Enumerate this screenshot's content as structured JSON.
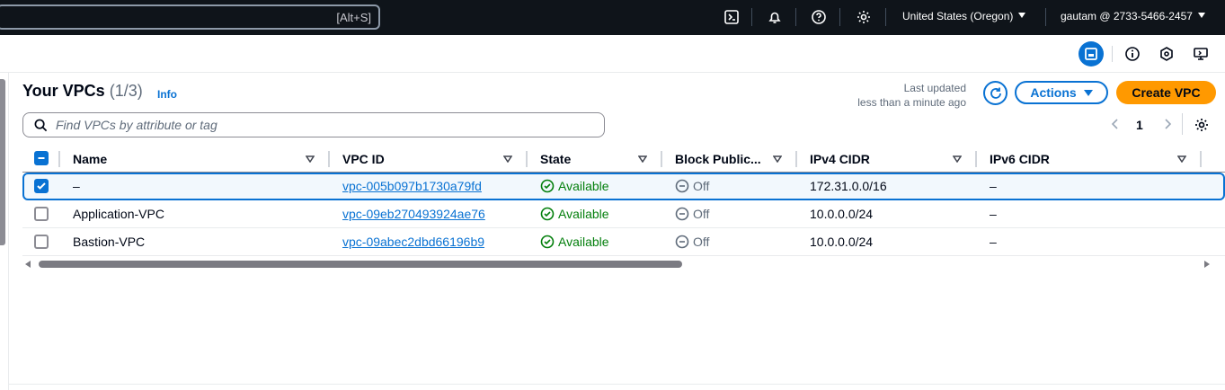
{
  "console": {
    "search_shortcut": "[Alt+S]",
    "region": "United States (Oregon)",
    "account": "gautam @ 2733-5466-2457"
  },
  "panel": {
    "title": "Your VPCs",
    "count": "(1/3)",
    "info_label": "Info",
    "last_updated_label": "Last updated",
    "last_updated_value": "less than a minute ago",
    "actions_label": "Actions",
    "create_label": "Create VPC",
    "filter_placeholder": "Find VPCs by attribute or tag",
    "page_number": "1"
  },
  "table": {
    "columns": [
      "Name",
      "VPC ID",
      "State",
      "Block Public...",
      "IPv4 CIDR",
      "IPv6 CIDR"
    ],
    "rows": [
      {
        "selected": true,
        "name": "–",
        "vpc_id": "vpc-005b097b1730a79fd",
        "state": "Available",
        "block_public": "Off",
        "ipv4": "172.31.0.0/16",
        "ipv6": "–"
      },
      {
        "selected": false,
        "name": "Application-VPC",
        "vpc_id": "vpc-09eb270493924ae76",
        "state": "Available",
        "block_public": "Off",
        "ipv4": "10.0.0.0/24",
        "ipv6": "–"
      },
      {
        "selected": false,
        "name": "Bastion-VPC",
        "vpc_id": "vpc-09abec2dbd66196b9",
        "state": "Available",
        "block_public": "Off",
        "ipv4": "10.0.0.0/24",
        "ipv6": "–"
      }
    ]
  },
  "colors": {
    "topbar": "#0f141a",
    "accent": "#0972d3",
    "primary_button": "#ff9900",
    "success": "#037f0c"
  },
  "icons": [
    "cloudshell-icon",
    "bell-icon",
    "help-icon",
    "gear-icon",
    "panel-icon",
    "info-icon",
    "hexagon-icon",
    "remote-icon",
    "search-icon",
    "refresh-icon",
    "chevron-left-icon",
    "chevron-right-icon",
    "preferences-gear-icon",
    "status-check-icon",
    "status-off-icon"
  ]
}
